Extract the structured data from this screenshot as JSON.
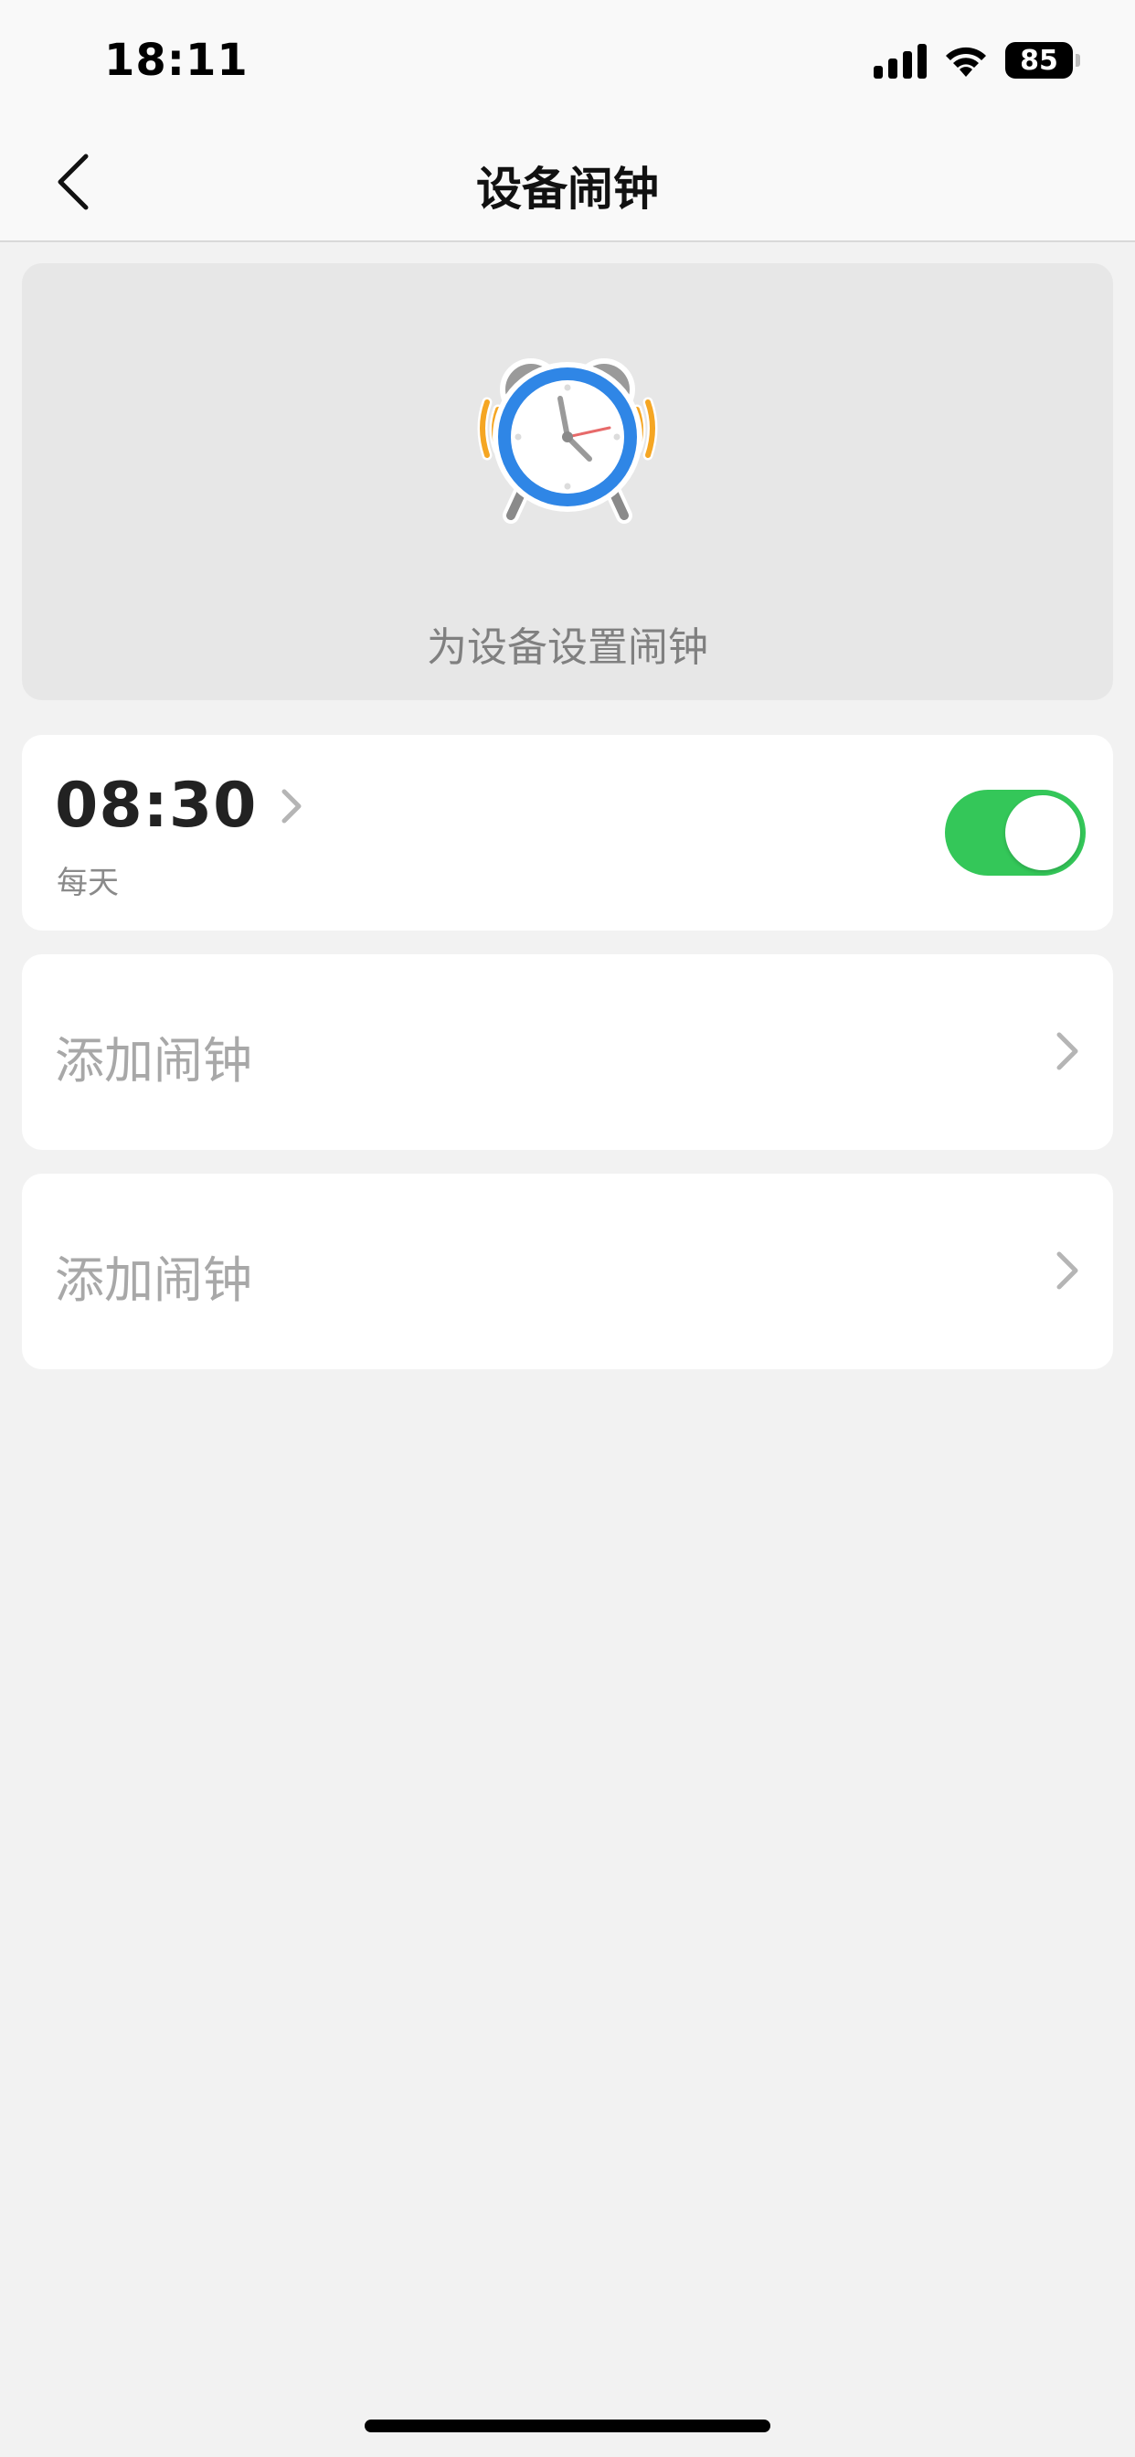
{
  "status_bar": {
    "time": "18:11",
    "battery_level": "85",
    "icons": [
      "signal-icon",
      "wifi-icon",
      "battery-icon"
    ]
  },
  "nav": {
    "title": "设备闹钟",
    "back_icon": "chevron-left-icon"
  },
  "hero": {
    "icon": "alarm-clock-icon",
    "caption": "为设备设置闹钟"
  },
  "alarms": [
    {
      "time": "08:30",
      "repeat": "每天",
      "enabled": true
    }
  ],
  "add_slots": [
    {
      "label": "添加闹钟"
    },
    {
      "label": "添加闹钟"
    }
  ],
  "colors": {
    "background": "#f2f2f2",
    "toggle_on": "#34c759",
    "clock_blue": "#2f86e6",
    "clock_bell_gray": "#9a9a9a",
    "ring_orange": "#f5a623",
    "second_hand": "#e76a6a"
  }
}
